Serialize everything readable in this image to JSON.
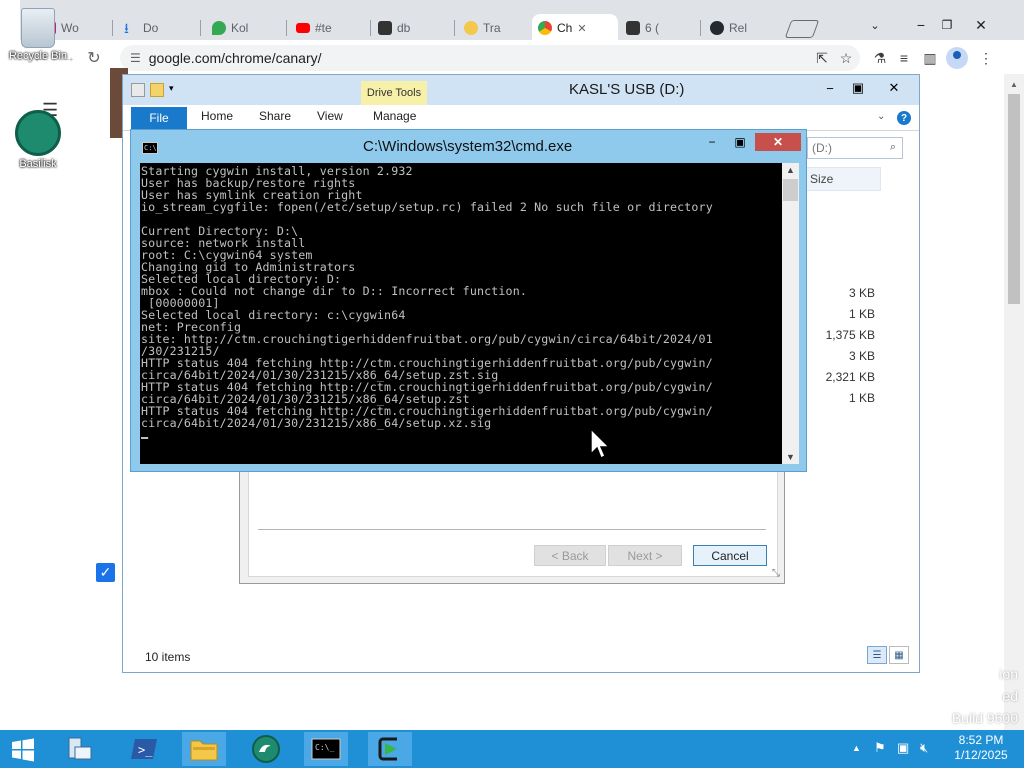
{
  "browser": {
    "tabs": [
      {
        "label": "Wo",
        "icon": "copilot-icon",
        "color": "#c02474"
      },
      {
        "label": "Do",
        "icon": "download-icon",
        "color": "#1a73e8"
      },
      {
        "label": "Kol",
        "icon": "maps-pin-icon",
        "color": "#34a853"
      },
      {
        "label": "#te",
        "icon": "youtube-icon",
        "color": "#ff0000"
      },
      {
        "label": "db",
        "icon": "dark-site-icon",
        "color": "#333333"
      },
      {
        "label": "Tra",
        "icon": "location-icon",
        "color": "#4a4a4a"
      },
      {
        "label": "Ch",
        "icon": "chrome-icon",
        "color": "#4285f4",
        "active": true
      },
      {
        "label": "6 (",
        "icon": "dark-site-icon",
        "color": "#333333"
      },
      {
        "label": "Rel",
        "icon": "github-icon",
        "color": "#24292f"
      }
    ],
    "url": "google.com/chrome/canary/"
  },
  "desktop": {
    "recycle_bin": "Recycle Bin",
    "basilisk": "Basilisk"
  },
  "explorer": {
    "title": "KASL'S USB (D:)",
    "context_tab": "Drive Tools",
    "ribbon_tabs": [
      "File",
      "Home",
      "Share",
      "View",
      "Manage"
    ],
    "search_placeholder": "(D:)",
    "size_header": "Size",
    "sizes": [
      "3 KB",
      "1 KB",
      "1,375 KB",
      "3 KB",
      "2,321 KB",
      "1 KB"
    ],
    "status": "10 items"
  },
  "setup": {
    "back": "< Back",
    "next": "Next >",
    "cancel": "Cancel"
  },
  "cmd": {
    "title": "C:\\Windows\\system32\\cmd.exe",
    "lines": [
      "Starting cygwin install, version 2.932",
      "User has backup/restore rights",
      "User has symlink creation right",
      "io_stream_cygfile: fopen(/etc/setup/setup.rc) failed 2 No such file or directory",
      "",
      "Current Directory: D:\\",
      "source: network install",
      "root: C:\\cygwin64 system",
      "Changing gid to Administrators",
      "Selected local directory: D:",
      "mbox : Could not change dir to D:: Incorrect function.",
      " [00000001]",
      "Selected local directory: c:\\cygwin64",
      "net: Preconfig",
      "site: http://ctm.crouchingtigerhiddenfruitbat.org/pub/cygwin/circa/64bit/2024/01",
      "/30/231215/",
      "HTTP status 404 fetching http://ctm.crouchingtigerhiddenfruitbat.org/pub/cygwin/",
      "circa/64bit/2024/01/30/231215/x86_64/setup.zst.sig",
      "HTTP status 404 fetching http://ctm.crouchingtigerhiddenfruitbat.org/pub/cygwin/",
      "circa/64bit/2024/01/30/231215/x86_64/setup.zst",
      "HTTP status 404 fetching http://ctm.crouchingtigerhiddenfruitbat.org/pub/cygwin/",
      "circa/64bit/2024/01/30/231215/x86_64/setup.xz.sig"
    ]
  },
  "watermark": [
    "ion",
    "ed",
    "Build 9600"
  ],
  "taskbar": {
    "time": "8:52 PM",
    "date": "1/12/2025"
  },
  "colors": {
    "taskbar": "#1f8fd6",
    "window_frame": "#cfe3f5",
    "cmd_frame": "#8fc9ec",
    "close_red": "#c7504c"
  }
}
